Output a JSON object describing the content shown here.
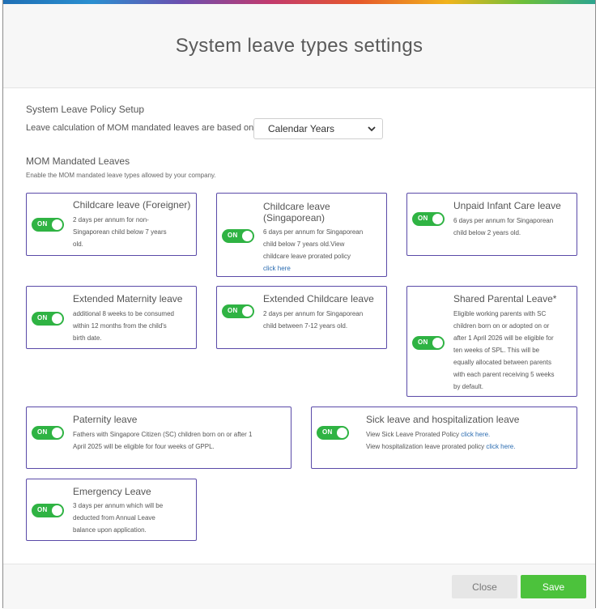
{
  "dialog": {
    "title": "System leave types settings"
  },
  "policy": {
    "heading": "System Leave Policy Setup",
    "calc_label": "Leave calculation of MOM mandated leaves are based on",
    "calc_value": "Calendar Years"
  },
  "mom": {
    "heading": "MOM Mandated Leaves",
    "note": "Enable the MOM mandated leave types allowed by your company."
  },
  "toggle_label": "ON",
  "cards": {
    "childcare_foreigner": {
      "title": "Childcare leave (Foreigner)",
      "lines": [
        "2 days per annum for non-",
        "Singaporean child below 7 years",
        "old."
      ]
    },
    "childcare_sg": {
      "title_lines": [
        "Childcare leave",
        "(Singaporean)"
      ],
      "lines": [
        "6 days per annum for Singaporean",
        "child below 7 years old.View",
        "childcare leave prorated policy"
      ],
      "link": "click here"
    },
    "unpaid_infant": {
      "title": "Unpaid Infant Care leave",
      "lines": [
        "6 days per annum for Singaporean",
        "child below 2 years old."
      ]
    },
    "extended_maternity": {
      "title": "Extended Maternity leave",
      "lines": [
        "additional 8 weeks to be consumed",
        "within 12 months from the child's",
        "birth date."
      ]
    },
    "extended_childcare": {
      "title": "Extended Childcare leave",
      "lines": [
        "2 days per annum for Singaporean",
        "child between 7-12 years old."
      ]
    },
    "shared_parental": {
      "title": "Shared Parental Leave*",
      "lines": [
        "Eligible working parents with SC",
        "children born on or adopted on or",
        "after 1 April 2026 will be eligible for",
        "ten weeks of SPL. This will be",
        "equally allocated between parents",
        "with each parent receiving 5 weeks",
        "by default."
      ]
    },
    "paternity": {
      "title": "Paternity leave",
      "lines": [
        "Fathers with Singapore Citizen (SC) children born on or after 1",
        "April 2025 will be eligible for four weeks of GPPL."
      ]
    },
    "sick": {
      "title": "Sick leave and hospitalization leave",
      "line1": "View Sick Leave Prorated Policy",
      "line2": "View hospitalization leave prorated policy",
      "link": "click here."
    },
    "emergency": {
      "title": "Emergency Leave",
      "lines": [
        "3 days per annum which will be",
        "deducted from Annual Leave",
        "balance upon application."
      ]
    }
  },
  "footer": {
    "close_label": "Close",
    "save_label": "Save"
  },
  "colors": {
    "card_border": "#5a4aa8",
    "toggle_on": "#2fb343",
    "save": "#4cc23c",
    "link": "#2a6bb0"
  }
}
